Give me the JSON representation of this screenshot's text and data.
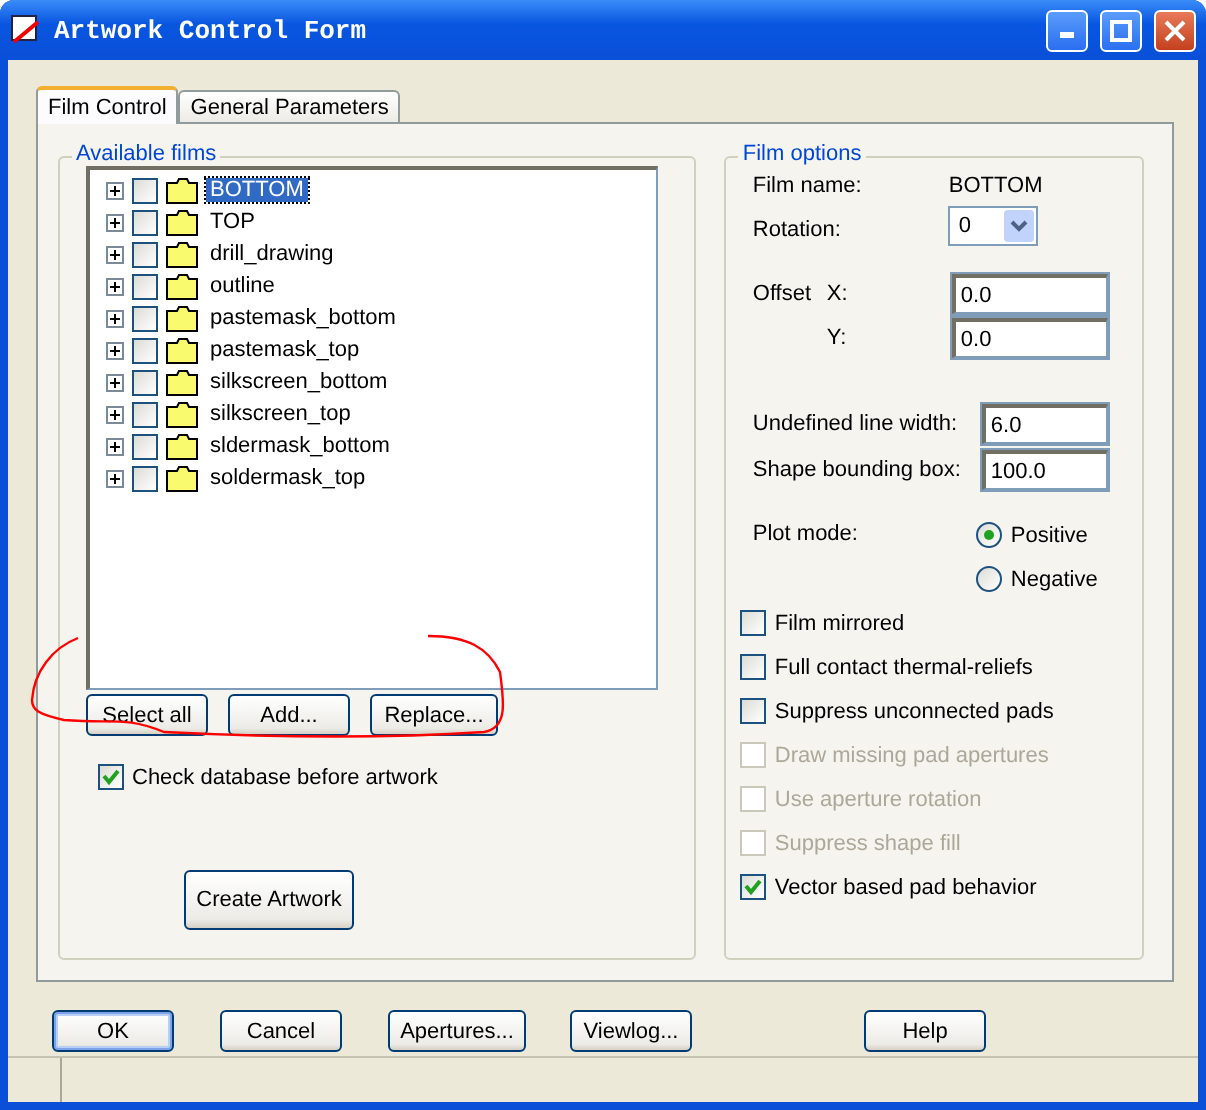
{
  "window": {
    "title": "Artwork Control Form"
  },
  "tabs": [
    {
      "label": "Film Control",
      "selected": true
    },
    {
      "label": "General Parameters",
      "selected": false
    }
  ],
  "films": {
    "title": "Available films",
    "items": [
      {
        "label": "BOTTOM",
        "checked": false,
        "selected": true
      },
      {
        "label": "TOP",
        "checked": false,
        "selected": false
      },
      {
        "label": "drill_drawing",
        "checked": false,
        "selected": false
      },
      {
        "label": "outline",
        "checked": false,
        "selected": false
      },
      {
        "label": "pastemask_bottom",
        "checked": false,
        "selected": false
      },
      {
        "label": "pastemask_top",
        "checked": false,
        "selected": false
      },
      {
        "label": "silkscreen_bottom",
        "checked": false,
        "selected": false
      },
      {
        "label": "silkscreen_top",
        "checked": false,
        "selected": false
      },
      {
        "label": "sldermask_bottom",
        "checked": false,
        "selected": false
      },
      {
        "label": "soldermask_top",
        "checked": false,
        "selected": false
      }
    ],
    "buttons": [
      "Select all",
      "Add...",
      "Replace..."
    ],
    "check_database": {
      "label": "Check database before artwork",
      "checked": true
    },
    "create_button": "Create Artwork"
  },
  "film_options": {
    "title": "Film options",
    "film_name": {
      "label": "Film name:",
      "value": "BOTTOM"
    },
    "rotation": {
      "label": "Rotation:",
      "value": "0"
    },
    "offset": {
      "label": "Offset",
      "x_label": "X:",
      "x_value": "0.0",
      "y_label": "Y:",
      "y_value": "0.0"
    },
    "line_width": {
      "label": "Undefined line width:",
      "value": "6.0"
    },
    "shape_box": {
      "label": "Shape bounding box:",
      "value": "100.0"
    },
    "plot_mode": {
      "label": "Plot mode:",
      "options": [
        {
          "label": "Positive",
          "selected": true
        },
        {
          "label": "Negative",
          "selected": false
        }
      ]
    },
    "options": [
      {
        "label": "Film mirrored",
        "checked": false,
        "disabled": false
      },
      {
        "label": "Full contact thermal-reliefs",
        "checked": false,
        "disabled": false
      },
      {
        "label": "Suppress unconnected pads",
        "checked": false,
        "disabled": false
      },
      {
        "label": "Draw missing pad apertures",
        "checked": false,
        "disabled": true
      },
      {
        "label": "Use aperture rotation",
        "checked": false,
        "disabled": true
      },
      {
        "label": "Suppress shape fill",
        "checked": false,
        "disabled": true
      },
      {
        "label": "Vector based pad behavior",
        "checked": true,
        "disabled": false
      }
    ]
  },
  "footer_buttons": [
    {
      "label": "OK",
      "default": true
    },
    {
      "label": "Cancel",
      "default": false
    },
    {
      "label": "Apertures...",
      "default": false
    },
    {
      "label": "Viewlog...",
      "default": false
    },
    {
      "label": "Help",
      "default": false
    }
  ]
}
